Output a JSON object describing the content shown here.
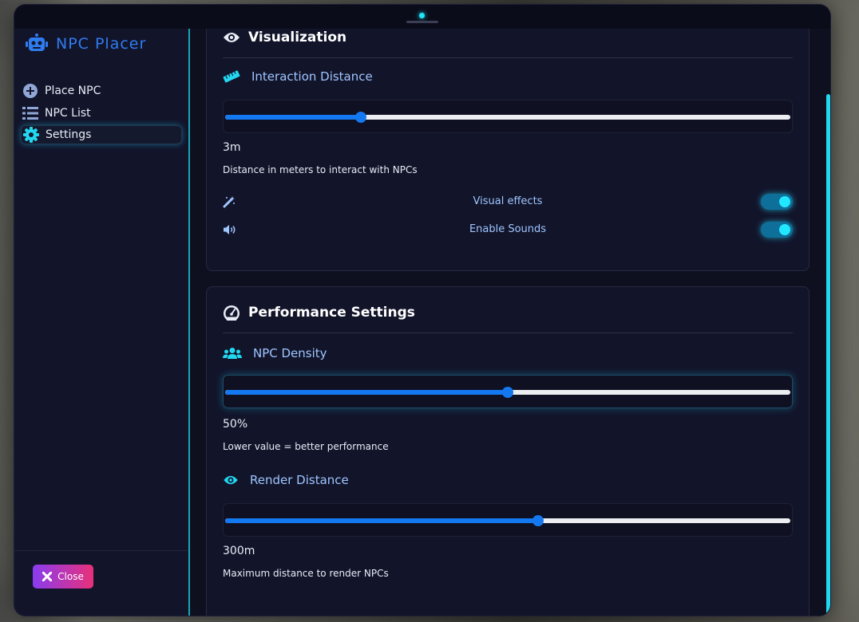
{
  "colors": {
    "accent": "#22e6f5",
    "slider_fill": "#1479f0",
    "label_blue": "#9ec6ff",
    "brand_blue": "#2f7cf0",
    "close_gradient_start": "#8a3cf0",
    "close_gradient_end": "#e8307a"
  },
  "brand": {
    "title": "NPC Placer",
    "icon": "robot-icon"
  },
  "sidebar": {
    "items": [
      {
        "label": "Place NPC",
        "icon": "plus-circle-icon",
        "active": false
      },
      {
        "label": "NPC List",
        "icon": "list-icon",
        "active": false
      },
      {
        "label": "Settings",
        "icon": "gear-icon",
        "active": true
      }
    ],
    "close_label": "Close",
    "close_icon": "x-icon"
  },
  "visualization": {
    "title": "Visualization",
    "icon": "eye-icon",
    "interaction": {
      "label": "Interaction Distance",
      "icon": "ruler-icon",
      "value_text": "3m",
      "fill_fraction": 0.24,
      "description": "Distance in meters to interact with NPCs"
    },
    "toggles": [
      {
        "label": "Visual effects",
        "icon": "magic-wand-icon",
        "on": true
      },
      {
        "label": "Enable Sounds",
        "icon": "speaker-icon",
        "on": true
      }
    ]
  },
  "performance": {
    "title": "Performance Settings",
    "icon": "gauge-icon",
    "density": {
      "label": "NPC Density",
      "icon": "users-icon",
      "value_text": "50%",
      "fill_fraction": 0.5,
      "description": "Lower value = better performance"
    },
    "render": {
      "label": "Render Distance",
      "icon": "eye-icon",
      "value_text": "300m",
      "fill_fraction": 0.553,
      "description": "Maximum distance to render NPCs"
    }
  }
}
